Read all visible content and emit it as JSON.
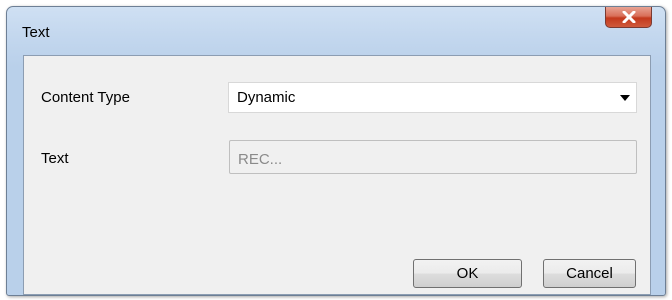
{
  "window": {
    "title": "Text",
    "close_icon": "close-x-icon"
  },
  "form": {
    "content_type_label": "Content Type",
    "content_type_value": "Dynamic",
    "text_label": "Text",
    "text_value": "REC..."
  },
  "buttons": {
    "ok_label": "OK",
    "cancel_label": "Cancel"
  },
  "colors": {
    "close_button": "#c9472c",
    "frame": "#b9d0ea",
    "client_background": "#f0f0f0"
  }
}
